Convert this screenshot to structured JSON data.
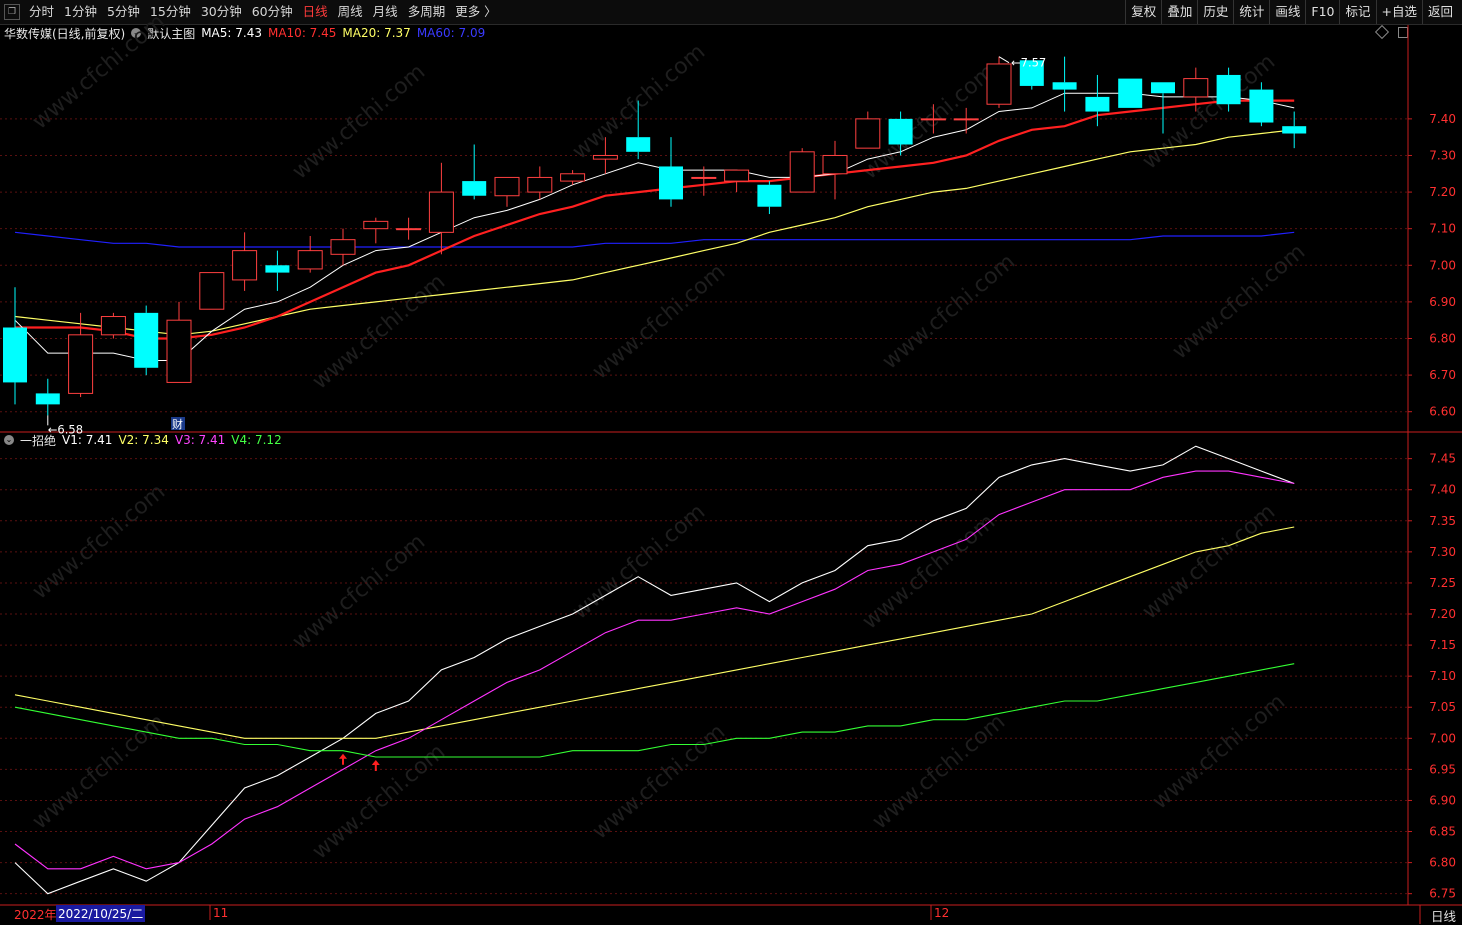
{
  "toolbar": {
    "periods": [
      "分时",
      "1分钟",
      "5分钟",
      "15分钟",
      "30分钟",
      "60分钟",
      "日线",
      "周线",
      "月线",
      "多周期",
      "更多 〉"
    ],
    "active_period": "日线",
    "right_buttons": [
      "复权",
      "叠加",
      "历史",
      "统计",
      "画线",
      "F10",
      "标记",
      "+自选",
      "返回"
    ]
  },
  "main_legend": {
    "stock_name": "华数传媒(日线,前复权)",
    "template_label": "默认主图",
    "ma5": "MA5: 7.43",
    "ma10": "MA10: 7.45",
    "ma20": "MA20: 7.37",
    "ma60": "MA60: 7.09"
  },
  "sub_legend": {
    "indicator_name": "一招绝",
    "v1": "V1: 7.41",
    "v2": "V2: 7.34",
    "v3": "V3: 7.41",
    "v4": "V4: 7.12"
  },
  "annotations": {
    "high_label": "7.57",
    "low_label": "6.58",
    "finance_badge": "财"
  },
  "colors": {
    "up": "#ff4040",
    "down": "#00ffff",
    "ma5": "#ffffff",
    "ma10": "#ff2020",
    "ma20": "#ffff66",
    "ma60": "#2020ff",
    "v1": "#ffffff",
    "v2": "#ffff66",
    "v3": "#ff33ff",
    "v4": "#33ff33",
    "axis": "#c81e1e",
    "grid": "#5a1010"
  },
  "date_axis": {
    "year_label": "2022年",
    "cursor_date": "2022/10/25/二",
    "month_labels": [
      "11",
      "12"
    ]
  },
  "bottom_right_period": "日线",
  "watermark": "www.cfchi.com",
  "chart_data": [
    {
      "type": "candlestick",
      "title": "华数传媒(日线,前复权)",
      "y_axis_ticks": [
        7.4,
        7.3,
        7.2,
        7.1,
        7.0,
        6.9,
        6.8,
        6.7,
        6.6
      ],
      "ylim": [
        6.55,
        7.61
      ],
      "candles": [
        {
          "o": 6.83,
          "h": 6.94,
          "l": 6.62,
          "c": 6.68
        },
        {
          "o": 6.65,
          "h": 6.69,
          "l": 6.59,
          "c": 6.62
        },
        {
          "o": 6.65,
          "h": 6.87,
          "l": 6.64,
          "c": 6.81
        },
        {
          "o": 6.81,
          "h": 6.87,
          "l": 6.8,
          "c": 6.86
        },
        {
          "o": 6.87,
          "h": 6.89,
          "l": 6.7,
          "c": 6.72
        },
        {
          "o": 6.68,
          "h": 6.9,
          "l": 6.68,
          "c": 6.85
        },
        {
          "o": 6.88,
          "h": 6.98,
          "l": 6.88,
          "c": 6.98
        },
        {
          "o": 6.96,
          "h": 7.09,
          "l": 6.93,
          "c": 7.04
        },
        {
          "o": 7.0,
          "h": 7.04,
          "l": 6.93,
          "c": 6.98
        },
        {
          "o": 6.99,
          "h": 7.08,
          "l": 6.98,
          "c": 7.04
        },
        {
          "o": 7.03,
          "h": 7.1,
          "l": 7.0,
          "c": 7.07
        },
        {
          "o": 7.1,
          "h": 7.13,
          "l": 7.06,
          "c": 7.12
        },
        {
          "o": 7.1,
          "h": 7.13,
          "l": 7.07,
          "c": 7.1
        },
        {
          "o": 7.09,
          "h": 7.28,
          "l": 7.03,
          "c": 7.2
        },
        {
          "o": 7.23,
          "h": 7.33,
          "l": 7.18,
          "c": 7.19
        },
        {
          "o": 7.19,
          "h": 7.24,
          "l": 7.16,
          "c": 7.24
        },
        {
          "o": 7.2,
          "h": 7.27,
          "l": 7.18,
          "c": 7.24
        },
        {
          "o": 7.23,
          "h": 7.26,
          "l": 7.22,
          "c": 7.25
        },
        {
          "o": 7.29,
          "h": 7.35,
          "l": 7.25,
          "c": 7.3
        },
        {
          "o": 7.35,
          "h": 7.45,
          "l": 7.29,
          "c": 7.31
        },
        {
          "o": 7.27,
          "h": 7.35,
          "l": 7.16,
          "c": 7.18
        },
        {
          "o": 7.24,
          "h": 7.27,
          "l": 7.19,
          "c": 7.24
        },
        {
          "o": 7.23,
          "h": 7.26,
          "l": 7.2,
          "c": 7.26
        },
        {
          "o": 7.22,
          "h": 7.23,
          "l": 7.14,
          "c": 7.16
        },
        {
          "o": 7.2,
          "h": 7.32,
          "l": 7.2,
          "c": 7.31
        },
        {
          "o": 7.25,
          "h": 7.34,
          "l": 7.18,
          "c": 7.3
        },
        {
          "o": 7.32,
          "h": 7.42,
          "l": 7.32,
          "c": 7.4
        },
        {
          "o": 7.4,
          "h": 7.42,
          "l": 7.3,
          "c": 7.33
        },
        {
          "o": 7.4,
          "h": 7.44,
          "l": 7.36,
          "c": 7.4
        },
        {
          "o": 7.4,
          "h": 7.43,
          "l": 7.36,
          "c": 7.4
        },
        {
          "o": 7.44,
          "h": 7.57,
          "l": 7.43,
          "c": 7.55
        },
        {
          "o": 7.56,
          "h": 7.56,
          "l": 7.48,
          "c": 7.49
        },
        {
          "o": 7.5,
          "h": 7.57,
          "l": 7.42,
          "c": 7.48
        },
        {
          "o": 7.46,
          "h": 7.52,
          "l": 7.38,
          "c": 7.42
        },
        {
          "o": 7.51,
          "h": 7.51,
          "l": 7.43,
          "c": 7.43
        },
        {
          "o": 7.5,
          "h": 7.5,
          "l": 7.36,
          "c": 7.47
        },
        {
          "o": 7.46,
          "h": 7.54,
          "l": 7.42,
          "c": 7.51
        },
        {
          "o": 7.52,
          "h": 7.54,
          "l": 7.42,
          "c": 7.44
        },
        {
          "o": 7.48,
          "h": 7.5,
          "l": 7.38,
          "c": 7.39
        },
        {
          "o": 7.38,
          "h": 7.42,
          "l": 7.32,
          "c": 7.36
        }
      ],
      "ma5": [
        6.85,
        6.76,
        6.76,
        6.76,
        6.74,
        6.74,
        6.82,
        6.88,
        6.9,
        6.94,
        7.0,
        7.04,
        7.05,
        7.09,
        7.13,
        7.15,
        7.18,
        7.22,
        7.25,
        7.28,
        7.26,
        7.26,
        7.26,
        7.24,
        7.24,
        7.25,
        7.29,
        7.31,
        7.35,
        7.37,
        7.42,
        7.43,
        7.47,
        7.47,
        7.47,
        7.46,
        7.46,
        7.46,
        7.45,
        7.43
      ],
      "ma10": [
        6.83,
        6.83,
        6.83,
        6.82,
        6.8,
        6.8,
        6.81,
        6.83,
        6.86,
        6.9,
        6.94,
        6.98,
        7.0,
        7.04,
        7.08,
        7.11,
        7.14,
        7.16,
        7.19,
        7.2,
        7.21,
        7.22,
        7.23,
        7.23,
        7.24,
        7.25,
        7.26,
        7.27,
        7.28,
        7.3,
        7.34,
        7.37,
        7.38,
        7.41,
        7.42,
        7.43,
        7.44,
        7.45,
        7.45,
        7.45
      ],
      "ma20": [
        6.86,
        6.85,
        6.84,
        6.83,
        6.82,
        6.81,
        6.82,
        6.84,
        6.86,
        6.88,
        6.89,
        6.9,
        6.91,
        6.92,
        6.93,
        6.94,
        6.95,
        6.96,
        6.98,
        7.0,
        7.02,
        7.04,
        7.06,
        7.09,
        7.11,
        7.13,
        7.16,
        7.18,
        7.2,
        7.21,
        7.23,
        7.25,
        7.27,
        7.29,
        7.31,
        7.32,
        7.33,
        7.35,
        7.36,
        7.37
      ],
      "ma60": [
        7.09,
        7.08,
        7.07,
        7.06,
        7.06,
        7.05,
        7.05,
        7.05,
        7.05,
        7.05,
        7.05,
        7.05,
        7.05,
        7.05,
        7.05,
        7.05,
        7.05,
        7.05,
        7.06,
        7.06,
        7.06,
        7.07,
        7.07,
        7.07,
        7.07,
        7.07,
        7.07,
        7.07,
        7.07,
        7.07,
        7.07,
        7.07,
        7.07,
        7.07,
        7.07,
        7.08,
        7.08,
        7.08,
        7.08,
        7.09
      ]
    },
    {
      "type": "line",
      "title": "一招绝",
      "y_axis_ticks": [
        7.45,
        7.4,
        7.35,
        7.3,
        7.25,
        7.2,
        7.15,
        7.1,
        7.05,
        7.0,
        6.95,
        6.9,
        6.85,
        6.8,
        6.75
      ],
      "ylim": [
        6.735,
        7.48
      ],
      "series": [
        {
          "name": "V1",
          "values": [
            6.8,
            6.75,
            6.77,
            6.79,
            6.77,
            6.8,
            6.86,
            6.92,
            6.94,
            6.97,
            7.0,
            7.04,
            7.06,
            7.11,
            7.13,
            7.16,
            7.18,
            7.2,
            7.23,
            7.26,
            7.23,
            7.24,
            7.25,
            7.22,
            7.25,
            7.27,
            7.31,
            7.32,
            7.35,
            7.37,
            7.42,
            7.44,
            7.45,
            7.44,
            7.43,
            7.44,
            7.47,
            7.45,
            7.43,
            7.41
          ]
        },
        {
          "name": "V2",
          "values": [
            7.07,
            7.06,
            7.05,
            7.04,
            7.03,
            7.02,
            7.01,
            7.0,
            7.0,
            7.0,
            7.0,
            7.0,
            7.01,
            7.02,
            7.03,
            7.04,
            7.05,
            7.06,
            7.07,
            7.08,
            7.09,
            7.1,
            7.11,
            7.12,
            7.13,
            7.14,
            7.15,
            7.16,
            7.17,
            7.18,
            7.19,
            7.2,
            7.22,
            7.24,
            7.26,
            7.28,
            7.3,
            7.31,
            7.33,
            7.34
          ]
        },
        {
          "name": "V3",
          "values": [
            6.83,
            6.79,
            6.79,
            6.81,
            6.79,
            6.8,
            6.83,
            6.87,
            6.89,
            6.92,
            6.95,
            6.98,
            7.0,
            7.03,
            7.06,
            7.09,
            7.11,
            7.14,
            7.17,
            7.19,
            7.19,
            7.2,
            7.21,
            7.2,
            7.22,
            7.24,
            7.27,
            7.28,
            7.3,
            7.32,
            7.36,
            7.38,
            7.4,
            7.4,
            7.4,
            7.42,
            7.43,
            7.43,
            7.42,
            7.41
          ]
        },
        {
          "name": "V4",
          "values": [
            7.05,
            7.04,
            7.03,
            7.02,
            7.01,
            7.0,
            7.0,
            6.99,
            6.99,
            6.98,
            6.98,
            6.97,
            6.97,
            6.97,
            6.97,
            6.97,
            6.97,
            6.98,
            6.98,
            6.98,
            6.99,
            6.99,
            7.0,
            7.0,
            7.01,
            7.01,
            7.02,
            7.02,
            7.03,
            7.03,
            7.04,
            7.05,
            7.06,
            7.06,
            7.07,
            7.08,
            7.09,
            7.1,
            7.11,
            7.12
          ]
        }
      ],
      "signal_arrows": [
        10,
        11
      ]
    }
  ]
}
